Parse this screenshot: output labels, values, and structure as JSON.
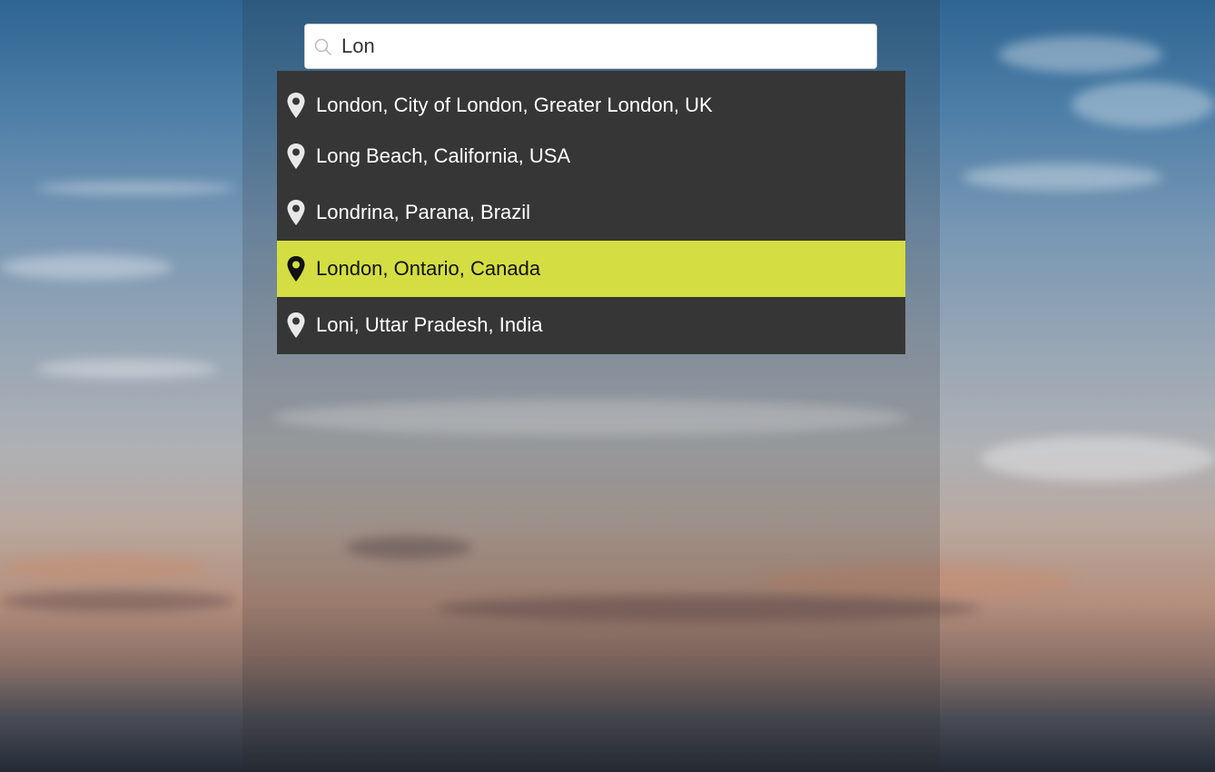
{
  "search": {
    "value": "Lon",
    "icon": "search-icon"
  },
  "suggestions": [
    {
      "label": "London, City of London, Greater London, UK",
      "icon": "map-pin-icon",
      "active": false
    },
    {
      "label": "Long Beach, California, USA",
      "icon": "map-pin-icon",
      "active": false
    },
    {
      "label": "Londrina, Parana, Brazil",
      "icon": "map-pin-icon",
      "active": false
    },
    {
      "label": "London, Ontario, Canada",
      "icon": "map-pin-icon",
      "active": true
    },
    {
      "label": "Loni, Uttar Pradesh, India",
      "icon": "map-pin-icon",
      "active": false
    }
  ],
  "colors": {
    "dropdown_bg": "#363636",
    "highlight": "#d4de42",
    "search_bg": "#ffffff"
  }
}
